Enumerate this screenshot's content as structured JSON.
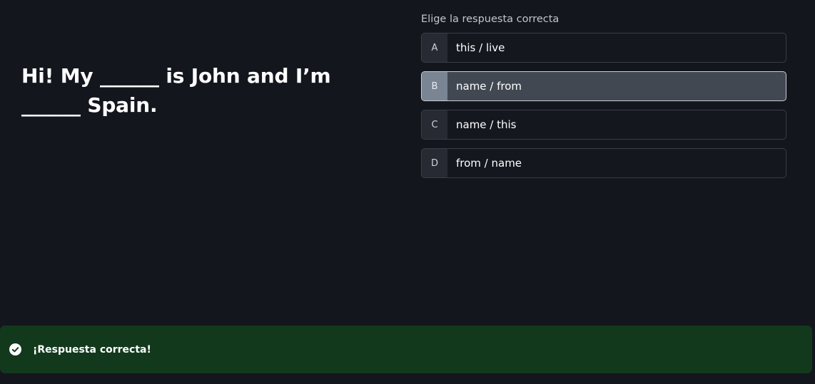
{
  "question": {
    "line1": "Hi! My ______ is John and I’m",
    "line2": "______ Spain."
  },
  "prompt": "Elige la respuesta correcta",
  "options": [
    {
      "letter": "A",
      "text": "this / live",
      "selected": false
    },
    {
      "letter": "B",
      "text": "name / from",
      "selected": true
    },
    {
      "letter": "C",
      "text": "name / this",
      "selected": false
    },
    {
      "letter": "D",
      "text": "from / name",
      "selected": false
    }
  ],
  "toast": {
    "icon": "check-circle-icon",
    "message": "¡Respuesta correcta!",
    "color": "#12391b"
  }
}
